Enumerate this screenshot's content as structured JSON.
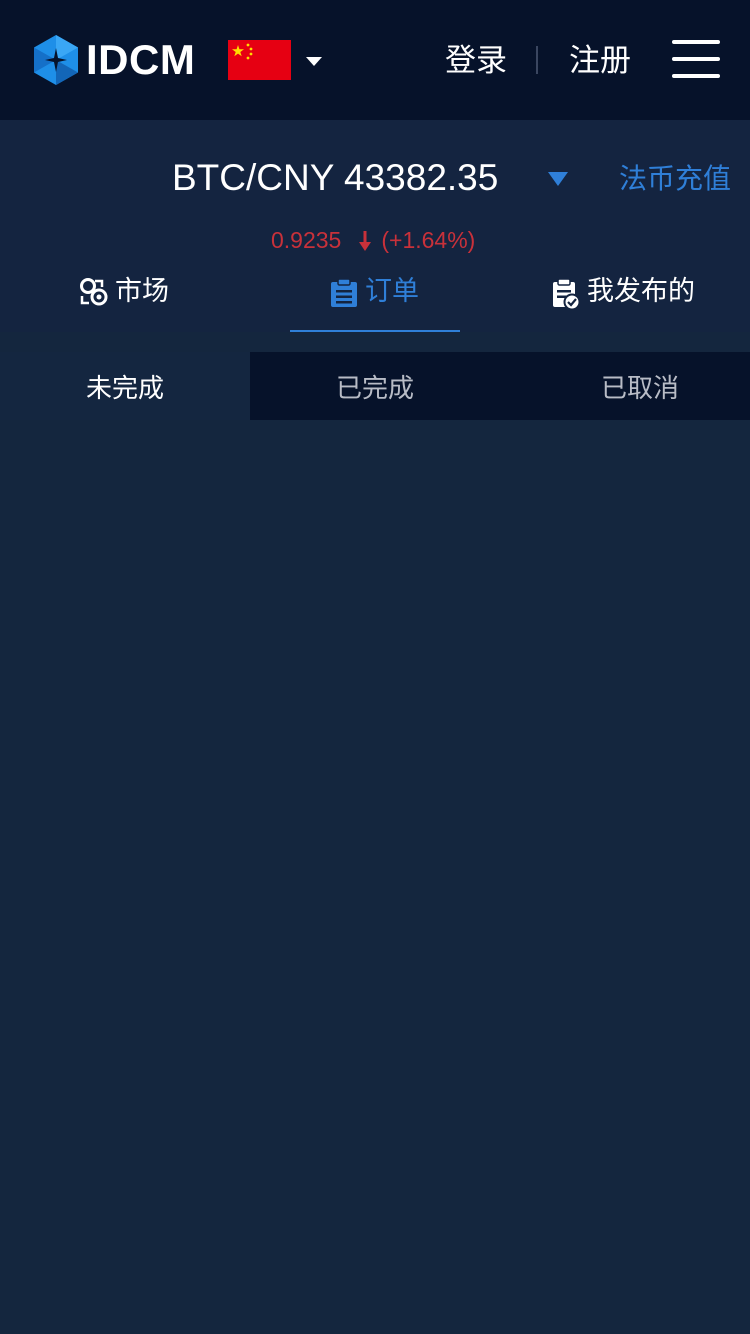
{
  "header": {
    "brand": "IDCM",
    "login_label": "登录",
    "register_label": "注册",
    "icons": {
      "logo": "idcm-logo-icon",
      "flag": "china-flag-icon",
      "caret": "caret-down-icon",
      "menu": "hamburger-menu-icon"
    }
  },
  "ticker": {
    "pair": "BTC/CNY",
    "price": "43382.35",
    "change": "0.9235",
    "change_pct": "(+1.64%)",
    "recharge_label": "法币充值"
  },
  "tabs": [
    {
      "label": "市场",
      "icon": "market-icon",
      "active": false
    },
    {
      "label": "订单",
      "icon": "clipboard-icon",
      "active": true
    },
    {
      "label": "我发布的",
      "icon": "published-icon",
      "active": false
    }
  ],
  "subtabs": [
    {
      "label": "未完成",
      "active": true
    },
    {
      "label": "已完成",
      "active": false
    },
    {
      "label": "已取消",
      "active": false
    }
  ],
  "colors": {
    "header_bg": "#06122a",
    "page_bg": "#14263e",
    "accent": "#2f7fd8",
    "down": "#c8313a"
  }
}
